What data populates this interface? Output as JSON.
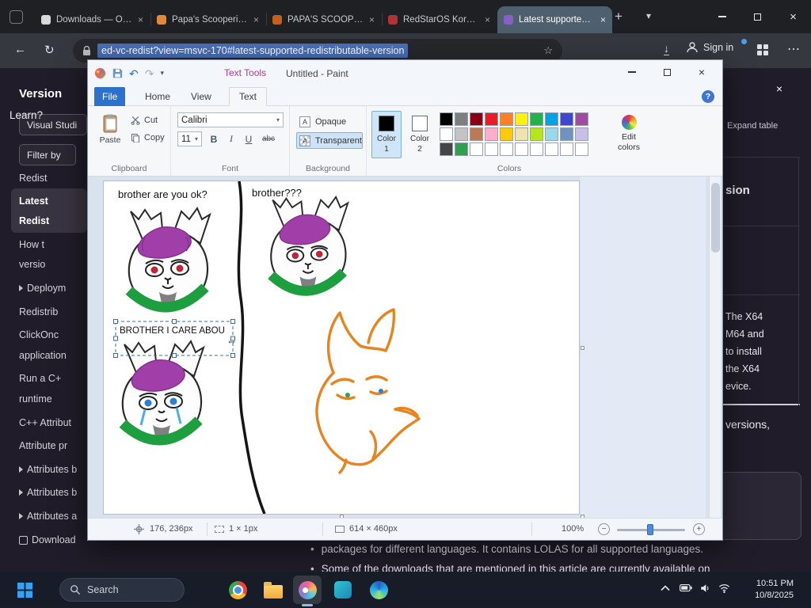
{
  "icons": {
    "back": "←",
    "refresh": "↻",
    "menu_dots": "⋯",
    "star": "☆",
    "close": "×",
    "new_tab": "+",
    "tab_list_chevron": "▾",
    "combo_caret": "▾",
    "undo": "↶",
    "redo": "↷",
    "help": "?",
    "zoom_out": "−",
    "zoom_in": "+",
    "bullet": "•",
    "move_cursor": "⇔",
    "downloads_arrow": "↓",
    "background_icon_letter": "A"
  },
  "browser": {
    "tabs": [
      {
        "title": "Downloads — O…",
        "favicon_color": "#d9d9d9"
      },
      {
        "title": "Papa's Scooperi…",
        "favicon_color": "#e2883a"
      },
      {
        "title": "PAPA'S SCOOPER…",
        "favicon_color": "#c2601f"
      },
      {
        "title": "RedStarOS Korea…",
        "favicon_color": "#b03434"
      },
      {
        "title": "Latest supporte…",
        "favicon_color": "#8661c5"
      }
    ],
    "url_selected_text": "ed-vc-redist?view=msvc-170#latest-supported-redistributable-version",
    "sign_in_label": "Sign in"
  },
  "docs_page": {
    "left_nav": {
      "heading": "Version",
      "version_selector_label": "Visual Studi",
      "filter_button_label": "Filter by",
      "items": [
        {
          "label": "Redist"
        },
        {
          "label": "Latest"
        },
        {
          "label": "Redist"
        },
        {
          "label": "How t"
        },
        {
          "label": "versio"
        },
        {
          "label": "Deploym"
        },
        {
          "label": "Redistrib"
        },
        {
          "label": "ClickOnc"
        },
        {
          "label": "application"
        },
        {
          "label": "Run a C+"
        },
        {
          "label": "runtime"
        },
        {
          "label": "C++ Attribut"
        },
        {
          "label": "Attribute pr"
        },
        {
          "label": "Attributes b"
        },
        {
          "label": "Attributes b"
        },
        {
          "label": "Attributes a"
        },
        {
          "label": "Download"
        }
      ]
    },
    "content": {
      "heading_fragment": "sion",
      "expand_table_label": "Expand table",
      "table_cell_lines": [
        "The X64",
        "M64 and",
        "to install",
        "the X64",
        "evice."
      ],
      "versions_fragment": "versions,",
      "feedback_fragment": "Learn?",
      "bottom_line_1": "packages for different languages. It contains LOLAS for all supported languages.",
      "bottom_line_2": "Some of the downloads that are mentioned in this article are currently available on"
    }
  },
  "paint": {
    "window_title": "Untitled - Paint",
    "contextual_tab_label": "Text Tools",
    "tabs": {
      "file": "File",
      "home": "Home",
      "view": "View",
      "text": "Text"
    },
    "ribbon": {
      "clipboard": {
        "group_label": "Clipboard",
        "paste": "Paste",
        "cut": "Cut",
        "copy": "Copy"
      },
      "font": {
        "group_label": "Font",
        "family_value": "Calibri",
        "size_value": "11",
        "bold": "B",
        "italic": "I",
        "underline": "U",
        "strikeout": "abc"
      },
      "background": {
        "group_label": "Background",
        "opaque": "Opaque",
        "transparent": "Transparent"
      },
      "colors": {
        "group_label": "Colors",
        "color1_label_line1": "Color",
        "color1_label_line2": "1",
        "color2_label_line1": "Color",
        "color2_label_line2": "2",
        "edit_label_line1": "Edit",
        "edit_label_line2": "colors",
        "color1_value": "#000000",
        "color2_value": "#ffffff",
        "palette_row1": [
          "#000000",
          "#7f7f7f",
          "#880015",
          "#ed1c24",
          "#ff7f27",
          "#fff200",
          "#22b14c",
          "#00a2e8",
          "#3f48cc",
          "#a349a4"
        ],
        "palette_row2": [
          "#ffffff",
          "#c3c3c3",
          "#b97a57",
          "#ffaec9",
          "#ffc90e",
          "#efe4b0",
          "#b5e61d",
          "#99d9ea",
          "#7092be",
          "#c8bfe7"
        ],
        "palette_row3": [
          "#454545",
          "#2da14b",
          "#ffffff",
          "#ffffff",
          "#ffffff",
          "#ffffff",
          "#ffffff",
          "#ffffff",
          "#ffffff",
          "#ffffff"
        ]
      }
    },
    "canvas_texts": {
      "top_left": "brother are you ok?",
      "top_middle": "brother???",
      "selection": "BROTHER I CARE ABOU"
    },
    "status_bar": {
      "cursor_position": "176, 236px",
      "selection_size": "1 × 1px",
      "canvas_size": "614 × 460px",
      "zoom_level": "100%"
    }
  },
  "taskbar": {
    "search_label": "Search",
    "clock_time": "10:51 PM",
    "clock_date": "10/8/2025"
  }
}
